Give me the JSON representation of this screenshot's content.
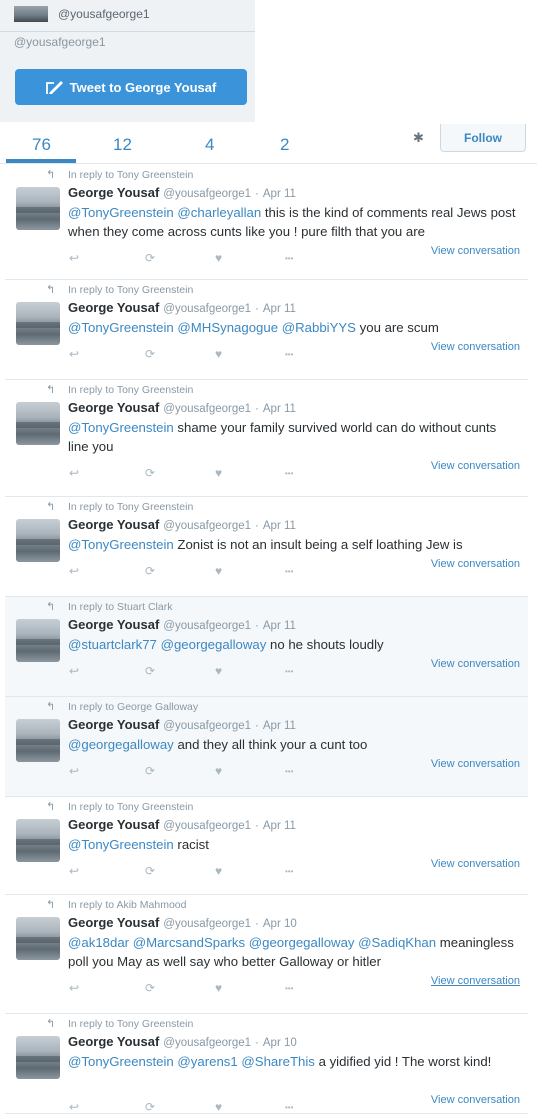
{
  "profile": {
    "handle_top": "@yousafgeorge1",
    "compose_placeholder": "@yousafgeorge1",
    "tweet_to_button": "Tweet to George Yousaf"
  },
  "stats": [
    {
      "value": "76"
    },
    {
      "value": "12"
    },
    {
      "value": "4"
    },
    {
      "value": "2"
    }
  ],
  "follow_label": "Follow",
  "tweets": [
    {
      "reply_to": "In reply to Tony Greenstein",
      "name": "George Yousaf",
      "handle": "@yousafgeorge1",
      "date": "Apr 11",
      "mentions": [
        "@TonyGreenstein",
        "@charleyallan"
      ],
      "text": "this is the kind of comments real Jews post when they come across cunts like you ! pure filth that you are",
      "view": "View conversation"
    },
    {
      "reply_to": "In reply to Tony Greenstein",
      "name": "George Yousaf",
      "handle": "@yousafgeorge1",
      "date": "Apr 11",
      "mentions": [
        "@TonyGreenstein",
        "@MHSynagogue",
        "@RabbiYYS"
      ],
      "text": "you are scum",
      "view": "View conversation"
    },
    {
      "reply_to": "In reply to Tony Greenstein",
      "name": "George Yousaf",
      "handle": "@yousafgeorge1",
      "date": "Apr 11",
      "mentions": [
        "@TonyGreenstein"
      ],
      "text": "shame your family survived world can do without cunts line you",
      "view": "View conversation"
    },
    {
      "reply_to": "In reply to Tony Greenstein",
      "name": "George Yousaf",
      "handle": "@yousafgeorge1",
      "date": "Apr 11",
      "mentions": [
        "@TonyGreenstein"
      ],
      "text": "Zonist is not an insult  being a self loathing Jew is",
      "view": "View conversation"
    },
    {
      "reply_to": "In reply to Stuart Clark",
      "name": "George Yousaf",
      "handle": "@yousafgeorge1",
      "date": "Apr 11",
      "mentions": [
        "@stuartclark77",
        "@georgegalloway"
      ],
      "text": "no he shouts loudly",
      "view": "View conversation"
    },
    {
      "reply_to": "In reply to George Galloway",
      "name": "George Yousaf",
      "handle": "@yousafgeorge1",
      "date": "Apr 11",
      "mentions": [
        "@georgegalloway"
      ],
      "text": "and they all think your a cunt too",
      "view": "View conversation"
    },
    {
      "reply_to": "In reply to Tony Greenstein",
      "name": "George Yousaf",
      "handle": "@yousafgeorge1",
      "date": "Apr 11",
      "mentions": [
        "@TonyGreenstein"
      ],
      "text": "racist",
      "view": "View conversation"
    },
    {
      "reply_to": "In reply to Akib Mahmood",
      "name": "George Yousaf",
      "handle": "@yousafgeorge1",
      "date": "Apr 10",
      "mentions": [
        "@ak18dar",
        "@MarcsandSparks",
        "@georgegalloway",
        "@SadiqKhan"
      ],
      "text": "meaningless  poll you May as well say who better Galloway or hitler",
      "view": "View conversation"
    },
    {
      "reply_to": "In reply to Tony Greenstein",
      "name": "George Yousaf",
      "handle": "@yousafgeorge1",
      "date": "Apr 10",
      "mentions": [
        "@TonyGreenstein",
        "@yarens1",
        "@ShareThis"
      ],
      "text": "a yidified yid ! The worst kind!",
      "view": "View conversation"
    }
  ],
  "icons": {
    "reply": "reply-icon",
    "retweet": "retweet-icon",
    "like": "heart-icon",
    "more": "more-icon"
  },
  "colors": {
    "accent": "#3b88c3",
    "button": "#3b94d9",
    "muted": "#8899a6"
  }
}
